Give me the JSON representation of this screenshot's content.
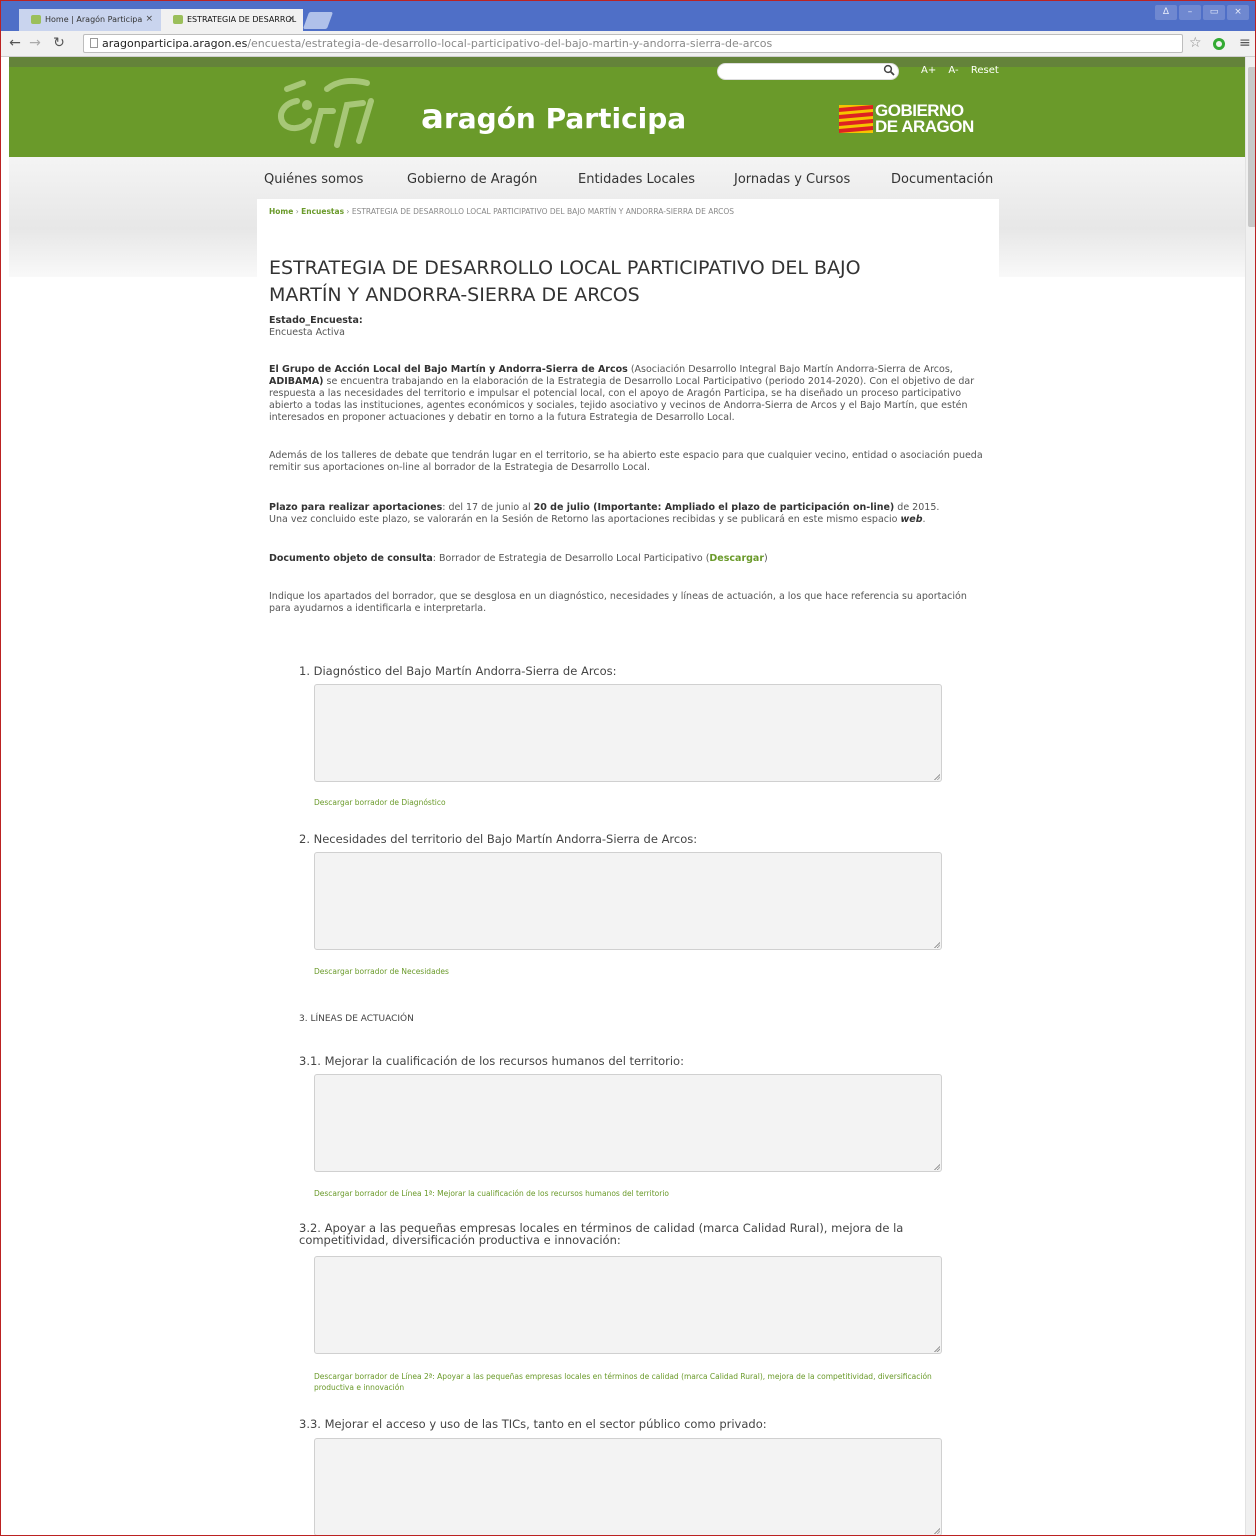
{
  "browser": {
    "tabs": [
      {
        "label": "Home | Aragón Participa",
        "active": false
      },
      {
        "label": "ESTRATEGIA DE DESARROL",
        "active": true
      }
    ],
    "url_host": "aragonparticipa.aragon.es",
    "url_path": "/encuesta/estrategia-de-desarrollo-local-participativo-del-bajo-martin-y-andorra-sierra-de-arcos",
    "window_controls": [
      "Δ",
      "–",
      "▭",
      "×"
    ]
  },
  "header": {
    "site_title_prefix": "a",
    "site_title_rest": "ragón Participa",
    "gov_line1": "GOBIERNO",
    "gov_line2": "DE ARAGON",
    "font_larger": "A+",
    "font_smaller": "A-",
    "font_reset": "Reset",
    "search_placeholder": ""
  },
  "nav": {
    "items": [
      "Quiénes somos",
      "Gobierno de Aragón",
      "Entidades Locales",
      "Jornadas y Cursos",
      "Documentación"
    ]
  },
  "breadcrumb": {
    "home": "Home",
    "sep": " › ",
    "encuestas": "Encuestas",
    "current": "ESTRATEGIA DE DESARROLLO LOCAL PARTICIPATIVO DEL BAJO MARTÍN Y ANDORRA-SIERRA DE ARCOS"
  },
  "page": {
    "title_line1": "ESTRATEGIA DE DESARROLLO LOCAL PARTICIPATIVO DEL BAJO",
    "title_line2": "MARTÍN Y ANDORRA-SIERRA DE ARCOS",
    "status_label": "Estado_Encuesta:",
    "status_value": "Encuesta Activa",
    "intro_bold": "El Grupo de Acción Local del Bajo Martín y Andorra-Sierra de Arcos",
    "intro_paren_open": " (Asociación Desarrollo Integral Bajo Martín Andorra-Sierra de Arcos, ",
    "intro_adibama": "ADIBAMA)",
    "intro_rest": " se encuentra trabajando en la elaboración de la Estrategia de Desarrollo Local Participativo (periodo 2014-2020). Con el objetivo de dar respuesta a las necesidades del territorio e impulsar el potencial local, con el apoyo de Aragón Participa, se ha diseñado un proceso participativo abierto a todas las instituciones, agentes económicos y sociales, tejido asociativo y vecinos de Andorra-Sierra de Arcos y el Bajo Martín, que estén interesados en proponer actuaciones y debatir en torno a la futura Estrategia de Desarrollo Local.",
    "talleres": "Además de los talleres de debate que tendrán lugar en el territorio, se ha abierto este espacio para que cualquier vecino, entidad o asociación pueda remitir sus aportaciones on-line al borrador de la Estrategia de Desarrollo Local.",
    "plazo_label": "Plazo para realizar aportaciones",
    "plazo_text1": ": del 17 de junio al ",
    "plazo_bold": "20 de julio (Importante: Ampliado el plazo de participación on-line)",
    "plazo_text2": " de 2015.",
    "plazo_line2": "Una vez concluido este plazo, se valorarán en la Sesión de Retorno las aportaciones recibidas y se publicará en este mismo espacio ",
    "plazo_web": "web",
    "plazo_end": ".",
    "doc_label": "Documento objeto de consulta",
    "doc_text": ": Borrador de Estrategia de Desarrollo Local Participativo (",
    "doc_link": "Descargar",
    "doc_close": ")",
    "indique": "Indique los apartados del borrador, que se desglosa en un diagnóstico, necesidades y líneas de actuación, a los que hace referencia su aportación para ayudarnos a identificarla e interpretarla."
  },
  "form": {
    "q1_label": "1. Diagnóstico del Bajo Martín Andorra-Sierra de Arcos:",
    "q1_link": "Descargar borrador de Diagnóstico",
    "q2_label": "2. Necesidades del territorio del Bajo Martín Andorra-Sierra de Arcos:",
    "q2_link": "Descargar borrador de Necesidades",
    "section3": "3. LÍNEAS DE ACTUACIÓN",
    "q31_label": "3.1. Mejorar la cualificación de los recursos humanos del territorio:",
    "q31_link": "Descargar borrador de Línea 1ª: Mejorar la cualificación de los recursos humanos del territorio",
    "q32_label": "3.2. Apoyar a las pequeñas empresas locales en términos de calidad (marca Calidad Rural), mejora de la competitividad, diversificación productiva e innovación:",
    "q32_link": "Descargar borrador de Línea 2ª: Apoyar a las pequeñas empresas locales en términos de calidad (marca Calidad Rural), mejora de la competitividad, diversificación productiva e innovación",
    "q33_label": "3.3. Mejorar el acceso y uso de las TICs, tanto en el sector público como privado:"
  },
  "colors": {
    "brand_green": "#6a9a2a",
    "tabstrip": "#4f6fc7"
  }
}
